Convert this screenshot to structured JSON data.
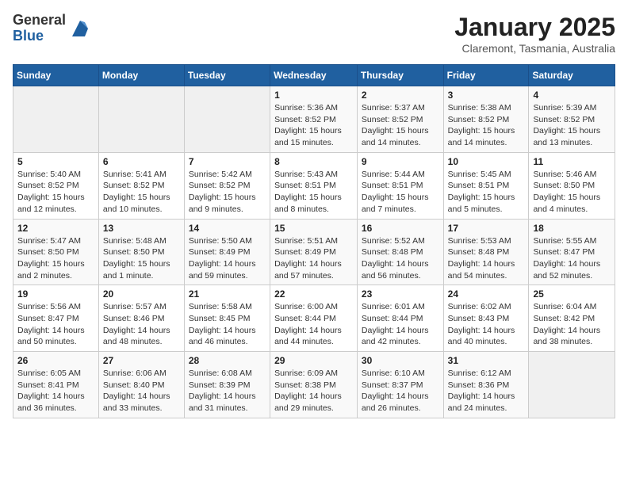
{
  "logo": {
    "general": "General",
    "blue": "Blue"
  },
  "title": "January 2025",
  "subtitle": "Claremont, Tasmania, Australia",
  "weekdays": [
    "Sunday",
    "Monday",
    "Tuesday",
    "Wednesday",
    "Thursday",
    "Friday",
    "Saturday"
  ],
  "weeks": [
    [
      {
        "day": "",
        "info": ""
      },
      {
        "day": "",
        "info": ""
      },
      {
        "day": "",
        "info": ""
      },
      {
        "day": "1",
        "info": "Sunrise: 5:36 AM\nSunset: 8:52 PM\nDaylight: 15 hours\nand 15 minutes."
      },
      {
        "day": "2",
        "info": "Sunrise: 5:37 AM\nSunset: 8:52 PM\nDaylight: 15 hours\nand 14 minutes."
      },
      {
        "day": "3",
        "info": "Sunrise: 5:38 AM\nSunset: 8:52 PM\nDaylight: 15 hours\nand 14 minutes."
      },
      {
        "day": "4",
        "info": "Sunrise: 5:39 AM\nSunset: 8:52 PM\nDaylight: 15 hours\nand 13 minutes."
      }
    ],
    [
      {
        "day": "5",
        "info": "Sunrise: 5:40 AM\nSunset: 8:52 PM\nDaylight: 15 hours\nand 12 minutes."
      },
      {
        "day": "6",
        "info": "Sunrise: 5:41 AM\nSunset: 8:52 PM\nDaylight: 15 hours\nand 10 minutes."
      },
      {
        "day": "7",
        "info": "Sunrise: 5:42 AM\nSunset: 8:52 PM\nDaylight: 15 hours\nand 9 minutes."
      },
      {
        "day": "8",
        "info": "Sunrise: 5:43 AM\nSunset: 8:51 PM\nDaylight: 15 hours\nand 8 minutes."
      },
      {
        "day": "9",
        "info": "Sunrise: 5:44 AM\nSunset: 8:51 PM\nDaylight: 15 hours\nand 7 minutes."
      },
      {
        "day": "10",
        "info": "Sunrise: 5:45 AM\nSunset: 8:51 PM\nDaylight: 15 hours\nand 5 minutes."
      },
      {
        "day": "11",
        "info": "Sunrise: 5:46 AM\nSunset: 8:50 PM\nDaylight: 15 hours\nand 4 minutes."
      }
    ],
    [
      {
        "day": "12",
        "info": "Sunrise: 5:47 AM\nSunset: 8:50 PM\nDaylight: 15 hours\nand 2 minutes."
      },
      {
        "day": "13",
        "info": "Sunrise: 5:48 AM\nSunset: 8:50 PM\nDaylight: 15 hours\nand 1 minute."
      },
      {
        "day": "14",
        "info": "Sunrise: 5:50 AM\nSunset: 8:49 PM\nDaylight: 14 hours\nand 59 minutes."
      },
      {
        "day": "15",
        "info": "Sunrise: 5:51 AM\nSunset: 8:49 PM\nDaylight: 14 hours\nand 57 minutes."
      },
      {
        "day": "16",
        "info": "Sunrise: 5:52 AM\nSunset: 8:48 PM\nDaylight: 14 hours\nand 56 minutes."
      },
      {
        "day": "17",
        "info": "Sunrise: 5:53 AM\nSunset: 8:48 PM\nDaylight: 14 hours\nand 54 minutes."
      },
      {
        "day": "18",
        "info": "Sunrise: 5:55 AM\nSunset: 8:47 PM\nDaylight: 14 hours\nand 52 minutes."
      }
    ],
    [
      {
        "day": "19",
        "info": "Sunrise: 5:56 AM\nSunset: 8:47 PM\nDaylight: 14 hours\nand 50 minutes."
      },
      {
        "day": "20",
        "info": "Sunrise: 5:57 AM\nSunset: 8:46 PM\nDaylight: 14 hours\nand 48 minutes."
      },
      {
        "day": "21",
        "info": "Sunrise: 5:58 AM\nSunset: 8:45 PM\nDaylight: 14 hours\nand 46 minutes."
      },
      {
        "day": "22",
        "info": "Sunrise: 6:00 AM\nSunset: 8:44 PM\nDaylight: 14 hours\nand 44 minutes."
      },
      {
        "day": "23",
        "info": "Sunrise: 6:01 AM\nSunset: 8:44 PM\nDaylight: 14 hours\nand 42 minutes."
      },
      {
        "day": "24",
        "info": "Sunrise: 6:02 AM\nSunset: 8:43 PM\nDaylight: 14 hours\nand 40 minutes."
      },
      {
        "day": "25",
        "info": "Sunrise: 6:04 AM\nSunset: 8:42 PM\nDaylight: 14 hours\nand 38 minutes."
      }
    ],
    [
      {
        "day": "26",
        "info": "Sunrise: 6:05 AM\nSunset: 8:41 PM\nDaylight: 14 hours\nand 36 minutes."
      },
      {
        "day": "27",
        "info": "Sunrise: 6:06 AM\nSunset: 8:40 PM\nDaylight: 14 hours\nand 33 minutes."
      },
      {
        "day": "28",
        "info": "Sunrise: 6:08 AM\nSunset: 8:39 PM\nDaylight: 14 hours\nand 31 minutes."
      },
      {
        "day": "29",
        "info": "Sunrise: 6:09 AM\nSunset: 8:38 PM\nDaylight: 14 hours\nand 29 minutes."
      },
      {
        "day": "30",
        "info": "Sunrise: 6:10 AM\nSunset: 8:37 PM\nDaylight: 14 hours\nand 26 minutes."
      },
      {
        "day": "31",
        "info": "Sunrise: 6:12 AM\nSunset: 8:36 PM\nDaylight: 14 hours\nand 24 minutes."
      },
      {
        "day": "",
        "info": ""
      }
    ]
  ]
}
